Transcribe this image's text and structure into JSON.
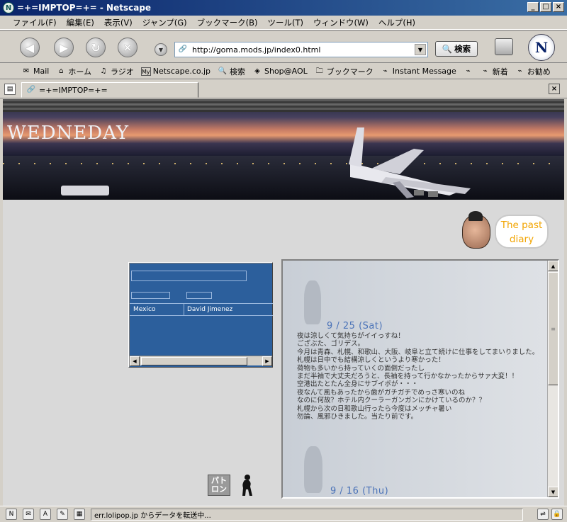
{
  "window": {
    "title": "=+=IMPTOP=+= - Netscape",
    "icon_letter": "N",
    "controls": {
      "minimize": "_",
      "maximize": "□",
      "close": "×"
    }
  },
  "menu": {
    "items": [
      "ファイル(F)",
      "編集(E)",
      "表示(V)",
      "ジャンプ(G)",
      "ブックマーク(B)",
      "ツール(T)",
      "ウィンドウ(W)",
      "ヘルプ(H)"
    ]
  },
  "navbar": {
    "url": "http://goma.mods.jp/index0.html",
    "search_label": "検索",
    "logo_letter": "N"
  },
  "personal_toolbar": {
    "items": [
      "Mail",
      "ホーム",
      "ラジオ",
      "Netscape.co.jp",
      "検索",
      "Shop@AOL",
      "ブックマーク",
      "Instant Message",
      "",
      "新着",
      "お勧め"
    ]
  },
  "tab": {
    "label": "=+=IMPTOP=+="
  },
  "page": {
    "banner_title": "WEDNEDAY",
    "past_diary": [
      "The past",
      "diary"
    ],
    "form_row": {
      "country": "Mexico",
      "name": "David Jimenez"
    },
    "entries": [
      {
        "date": "9 / 25 (Sat)",
        "lines": [
          "夜は涼しくて気持ちがイイっすね！",
          "ござぶた、ゴリデス。",
          "今月は青森、札幌、和歌山、大阪、岐阜と立て続けに仕事をしてまいりました。",
          "札幌は日中でも結構涼しくというより寒かった！",
          "荷物も多いから持っていくの面倒だったし",
          "まだ半袖で大丈夫だろうと、長袖を持って行かなかったからサァ大変！！",
          "空港出たとたん全身にサブイボが・・・",
          "夜なんて風もあったから歯がガチガチでめっさ寒いのね",
          "なのに何故？ホテル内クーラーガンガンにかけているのか？？",
          "札幌から次の日和歌山行ったら今度はメッチャ暑い",
          "勿論、風邪ひきました。当たり前です。"
        ]
      },
      {
        "date": "9 / 16 (Thu)",
        "lines": []
      }
    ],
    "patron_logo_text": "パトロン"
  },
  "status": {
    "text": "err.lolipop.jp からデータを転送中..."
  },
  "colors": {
    "title_bar": "#0a246a",
    "panel_blue": "#2c5f9c",
    "diary_date": "#4b73b8",
    "bubble_text": "#f2a400"
  }
}
